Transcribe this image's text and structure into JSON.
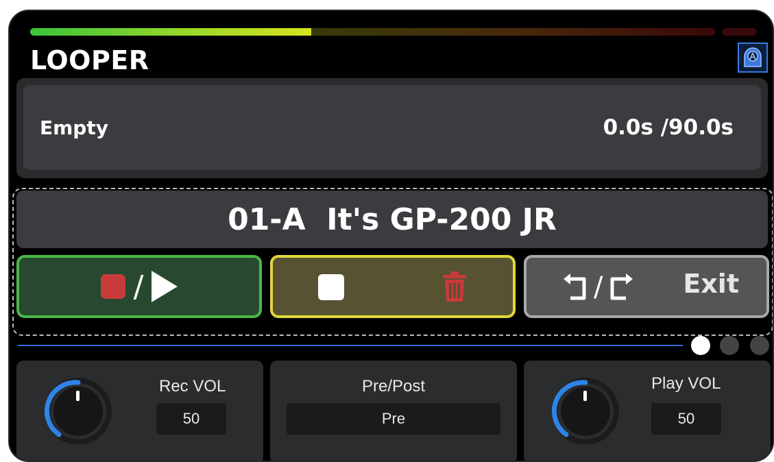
{
  "app": {
    "title": "LOOPER"
  },
  "meter": {
    "level": 0.41
  },
  "status": {
    "label": "Empty",
    "time": "0.0s /90.0s"
  },
  "preset": {
    "name": "01-A  It's GP-200 JR"
  },
  "footswitches": {
    "rec_play": {
      "slash": "/"
    },
    "stop_clear": {},
    "undo_exit": {
      "slash": "/",
      "exit_label": "Exit"
    }
  },
  "pages": {
    "count": 3,
    "active": 0
  },
  "params": [
    {
      "label": "Rec VOL",
      "value": "50",
      "knob_level": 0.5
    },
    {
      "label": "Pre/Post",
      "value": "Pre"
    },
    {
      "label": "Play VOL",
      "value": "50",
      "knob_level": 0.5
    }
  ],
  "colors": {
    "rec_border": "#49b847",
    "stop_border": "#e1d83b",
    "exit_border": "#a8a8a8",
    "accent": "#2f6fd6",
    "record_red": "#c93a3a"
  },
  "icons": [
    "tuner-icon",
    "record-icon",
    "play-icon",
    "stop-icon",
    "trash-icon",
    "undo-icon",
    "redo-icon",
    "knob-icon"
  ]
}
